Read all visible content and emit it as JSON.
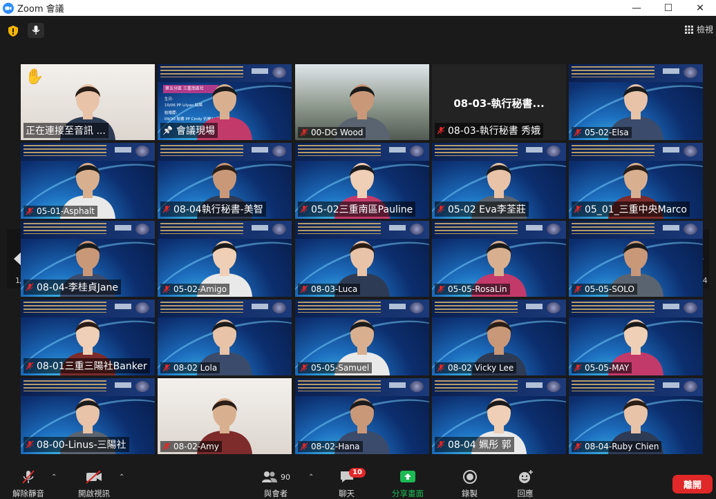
{
  "window": {
    "title": "Zoom 會議"
  },
  "topbar": {
    "view_label": "檢視"
  },
  "pagination": {
    "left": "1/4",
    "right": "1/4"
  },
  "tiles": [
    {
      "name": "正在連接至音訊 ...",
      "muted": false,
      "big": true
    },
    {
      "name": "會議現場",
      "muted": false,
      "pinned": true,
      "big": true
    },
    {
      "name": "00-DG Wood",
      "muted": true
    },
    {
      "name": "08-03-執行秘書 秀娥",
      "muted": true,
      "big": true
    },
    {
      "name": "05-02-Elsa",
      "muted": true
    },
    {
      "name": "05-01-Asphalt",
      "muted": true
    },
    {
      "name": "08-04執行秘書-美智",
      "muted": true,
      "big": true
    },
    {
      "name": "05-02三重南區Pauline",
      "muted": true,
      "big": true
    },
    {
      "name": "05-02 Eva李荃莊",
      "muted": true,
      "big": true
    },
    {
      "name": "05_01_三重中央Marco",
      "muted": true,
      "big": true
    },
    {
      "name": "08-04-李桂貞Jane",
      "muted": true,
      "big": true
    },
    {
      "name": "05-02-Amigo",
      "muted": true
    },
    {
      "name": "08-03-Luca",
      "muted": true
    },
    {
      "name": "05-05-RosaLin",
      "muted": true
    },
    {
      "name": "05-05-SOLO",
      "muted": true
    },
    {
      "name": "08-01三重三陽社Banker",
      "muted": true,
      "big": true
    },
    {
      "name": "08-02 Lola",
      "muted": true
    },
    {
      "name": "05-05-Samuel",
      "muted": true
    },
    {
      "name": "08-02 Vicky Lee",
      "muted": true
    },
    {
      "name": "05-05-MAY",
      "muted": true
    },
    {
      "name": "08-00-Linus-三陽社",
      "muted": true,
      "big": true
    },
    {
      "name": "08-02-Amy",
      "muted": true
    },
    {
      "name": "08-02-Hana",
      "muted": true
    },
    {
      "name": "08-04 姵彤 郭",
      "muted": true,
      "big": true
    },
    {
      "name": "08-04-Ruby Chien",
      "muted": true
    }
  ],
  "tile4_display_name": "08-03-執行秘書...",
  "slide": {
    "section": "第五分區 三重南區社",
    "birthday_label": "生日:",
    "birthday_text": "10/06 PP Lilyan 姑姬",
    "anniv_label": "結婚慶:",
    "anniv_text": "09/30 秘書 PP Cindy 伉儷31週年"
  },
  "toolbar": {
    "unmute": "解除靜音",
    "start_video": "開啟視訊",
    "participants": "與會者",
    "participants_count": "90",
    "chat": "聊天",
    "chat_badge": "10",
    "share": "分享畫面",
    "record": "錄製",
    "reactions": "回應",
    "leave": "離開"
  },
  "colors": {
    "speaking_outline": "#c8e53d",
    "share_green": "#1db954",
    "leave_red": "#e02828",
    "mute_red": "#e02828"
  }
}
